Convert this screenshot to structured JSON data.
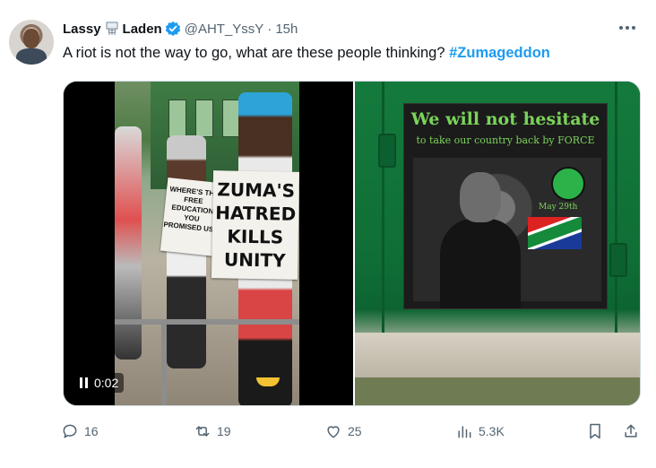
{
  "tweet": {
    "author_name": "Lassy",
    "author_name_tail": "Laden",
    "handle": "@AHT_YssY",
    "separator": "·",
    "time": "15h",
    "text": "A riot is not the way to go, what are these people thinking?",
    "hashtag": "#Zumageddon"
  },
  "media": {
    "video": {
      "timestamp": "0:02",
      "sign_left": "WHERE'S THE FREE EDUCATION YOU PROMISED US?",
      "sign_right_lines": [
        "ZUMA'S",
        "HATRED",
        "KILLS",
        "UNITY"
      ]
    },
    "photo": {
      "poster_title": "We will not hesitate",
      "poster_subtitle": "to take our country back by FORCE",
      "poster_date": "May 29th"
    }
  },
  "actions": {
    "replies": "16",
    "reposts": "19",
    "likes": "25",
    "views": "5.3K"
  },
  "colors": {
    "accent": "#1d9bf0",
    "muted": "#536471",
    "verified": "#1d9bf0",
    "photo_green": "#147a3c"
  },
  "icons": [
    "more-icon",
    "verified-badge-icon",
    "basketball-hoop-icon",
    "pause-icon",
    "reply-icon",
    "repost-icon",
    "like-icon",
    "views-icon",
    "bookmark-icon",
    "share-icon"
  ]
}
